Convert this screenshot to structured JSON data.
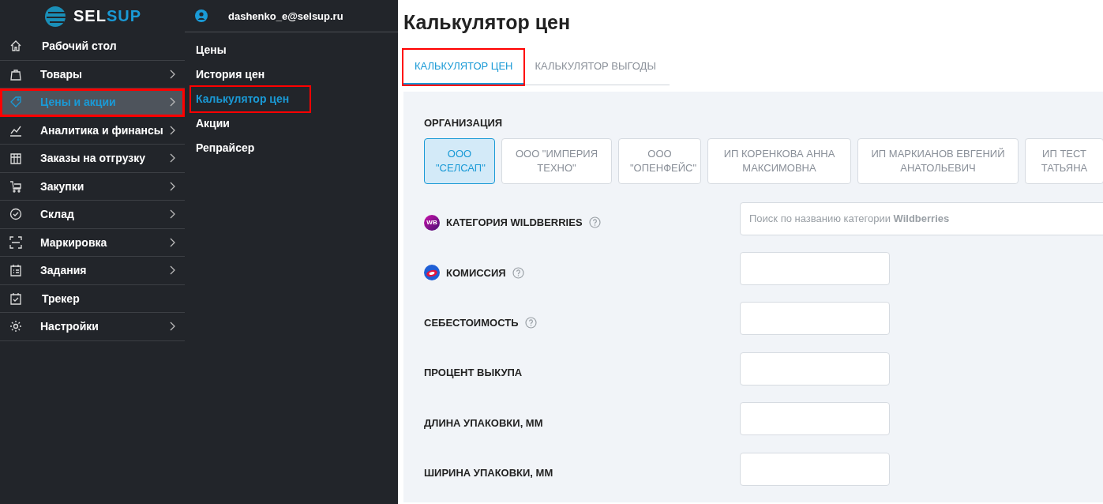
{
  "logo": {
    "text_left": "SEL",
    "text_right": "SUP"
  },
  "sidebar": {
    "items": [
      {
        "label": "Рабочий стол",
        "expandable": false,
        "selected": false,
        "highlighted": false
      },
      {
        "label": "Товары",
        "expandable": true,
        "selected": false,
        "highlighted": false
      },
      {
        "label": "Цены и акции",
        "expandable": true,
        "selected": true,
        "highlighted": true
      },
      {
        "label": "Аналитика и финансы",
        "expandable": true,
        "selected": false,
        "highlighted": false
      },
      {
        "label": "Заказы на отгрузку",
        "expandable": true,
        "selected": false,
        "highlighted": false
      },
      {
        "label": "Закупки",
        "expandable": true,
        "selected": false,
        "highlighted": false
      },
      {
        "label": "Склад",
        "expandable": true,
        "selected": false,
        "highlighted": false
      },
      {
        "label": "Маркировка",
        "expandable": true,
        "selected": false,
        "highlighted": false
      },
      {
        "label": "Задания",
        "expandable": true,
        "selected": false,
        "highlighted": false
      },
      {
        "label": "Трекер",
        "expandable": false,
        "selected": false,
        "highlighted": false
      },
      {
        "label": "Настройки",
        "expandable": true,
        "selected": false,
        "highlighted": false
      }
    ]
  },
  "submenu": {
    "user": "dashenko_e@selsup.ru",
    "items": [
      {
        "label": "Цены",
        "selected": false,
        "highlighted": false
      },
      {
        "label": "История цен",
        "selected": false,
        "highlighted": false
      },
      {
        "label": "Калькулятор цен",
        "selected": true,
        "highlighted": true
      },
      {
        "label": "Акции",
        "selected": false,
        "highlighted": false
      },
      {
        "label": "Репрайсер",
        "selected": false,
        "highlighted": false
      }
    ]
  },
  "page": {
    "title": "Калькулятор цен",
    "tabs": [
      {
        "label": "КАЛЬКУЛЯТОР ЦЕН",
        "selected": true,
        "highlighted": true
      },
      {
        "label": "КАЛЬКУЛЯТОР ВЫГОДЫ",
        "selected": false,
        "highlighted": false
      }
    ],
    "organization": {
      "label": "ОРГАНИЗАЦИЯ",
      "options": [
        {
          "label": "ООО \"СЕЛСАП\"",
          "selected": true
        },
        {
          "label": "ООО \"ИМПЕРИЯ ТЕХНО\"",
          "selected": false
        },
        {
          "label": "ООО \"ОПЕНФЕЙС\"",
          "selected": false
        },
        {
          "label": "ИП КОРЕНКОВА АННА МАКСИМОВНА",
          "selected": false
        },
        {
          "label": "ИП МАРКИАНОВ ЕВГЕНИЙ АНАТОЛЬЕВИЧ",
          "selected": false
        },
        {
          "label": "ИП ТЕСТ ТАТЬЯНА",
          "selected": false
        }
      ]
    },
    "fields": [
      {
        "label": "КАТЕГОРИЯ WILDBERRIES",
        "kind": "search",
        "logo": {
          "kind": "circle-text",
          "text": "WB"
        },
        "help": true,
        "placeholder": "Поиск по названию категории **Wildberries**"
      },
      {
        "label": "КОМИССИЯ",
        "kind": "input",
        "logo": {
          "kind": "ring"
        },
        "help": true
      },
      {
        "label": "СЕБЕСТОИМОСТЬ",
        "kind": "input",
        "help": true
      },
      {
        "label": "ПРОЦЕНТ ВЫКУПА",
        "kind": "input",
        "help": false
      },
      {
        "label": "ДЛИНА УПАКОВКИ, ММ",
        "kind": "input",
        "help": false
      },
      {
        "label": "ШИРИНА УПАКОВКИ, ММ",
        "kind": "input",
        "help": false
      }
    ]
  }
}
